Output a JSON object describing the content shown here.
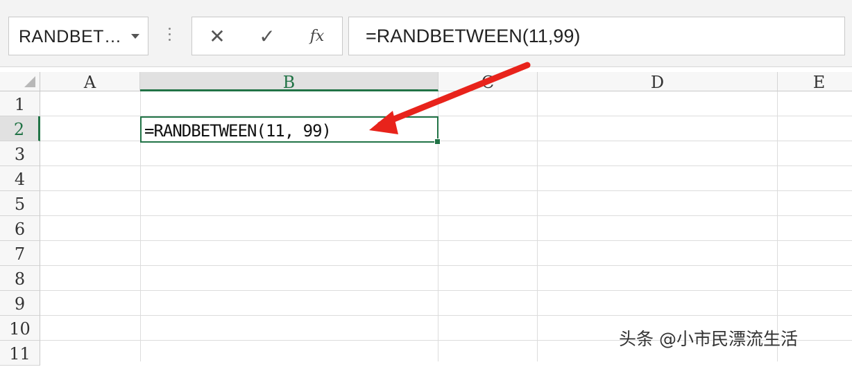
{
  "formula_bar": {
    "name_box": "RANDBET…",
    "cancel_symbol": "✕",
    "enter_symbol": "✓",
    "fx_symbol": "fx",
    "formula": "=RANDBETWEEN(11,99)"
  },
  "columns": [
    "A",
    "B",
    "C",
    "D",
    "E"
  ],
  "rows": [
    "1",
    "2",
    "3",
    "4",
    "5",
    "6",
    "7",
    "8",
    "9",
    "10",
    "11"
  ],
  "active_cell": {
    "ref": "B2",
    "content": "=RANDBETWEEN(11, 99)"
  },
  "annotation": {
    "arrow_color": "#e8231b"
  },
  "watermark": "头条 @小市民漂流生活",
  "colors": {
    "accent": "#217346"
  }
}
